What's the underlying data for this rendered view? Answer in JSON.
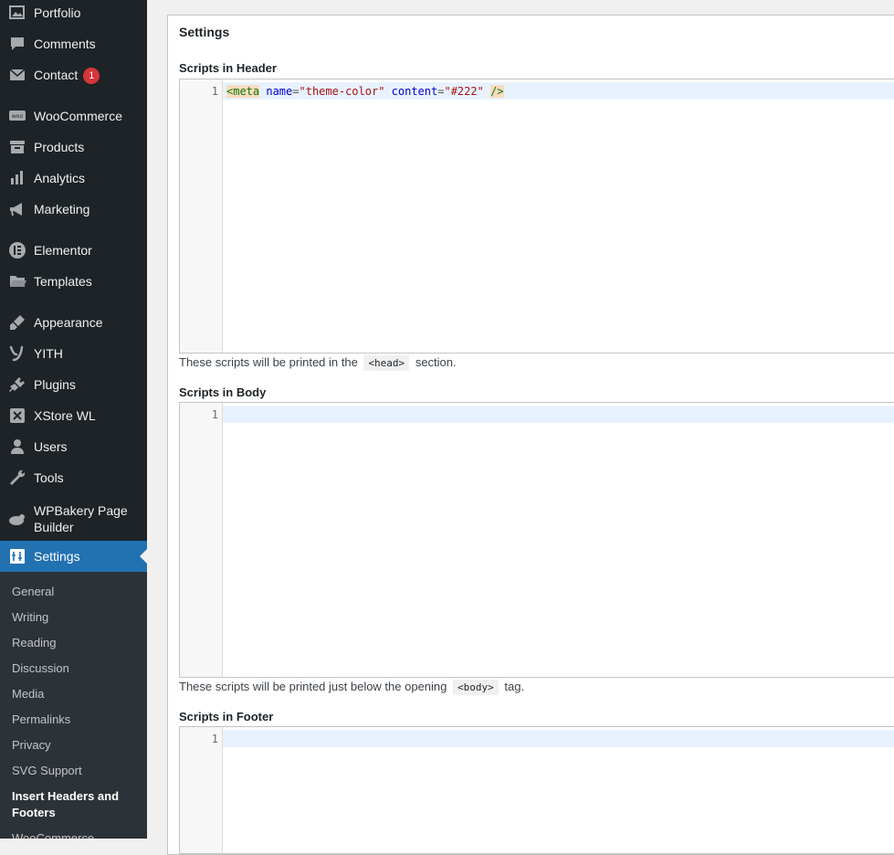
{
  "sidebar": {
    "items": [
      {
        "label": "Portfolio",
        "icon": "portfolio-icon"
      },
      {
        "label": "Comments",
        "icon": "comments-icon"
      },
      {
        "label": "Contact",
        "icon": "mail-icon",
        "badge": "1"
      },
      {
        "label": "WooCommerce",
        "icon": "woocommerce-icon"
      },
      {
        "label": "Products",
        "icon": "archive-icon"
      },
      {
        "label": "Analytics",
        "icon": "bar-chart-icon"
      },
      {
        "label": "Marketing",
        "icon": "megaphone-icon"
      },
      {
        "label": "Elementor",
        "icon": "elementor-icon"
      },
      {
        "label": "Templates",
        "icon": "folder-icon"
      },
      {
        "label": "Appearance",
        "icon": "brush-icon"
      },
      {
        "label": "YITH",
        "icon": "yith-icon"
      },
      {
        "label": "Plugins",
        "icon": "plug-icon"
      },
      {
        "label": "XStore WL",
        "icon": "xstore-icon"
      },
      {
        "label": "Users",
        "icon": "user-icon"
      },
      {
        "label": "Tools",
        "icon": "wrench-icon"
      },
      {
        "label": "WPBakery Page Builder",
        "icon": "wpbakery-icon"
      },
      {
        "label": "Settings",
        "icon": "settings-icon",
        "active": true
      }
    ],
    "submenu": [
      {
        "label": "General"
      },
      {
        "label": "Writing"
      },
      {
        "label": "Reading"
      },
      {
        "label": "Discussion"
      },
      {
        "label": "Media"
      },
      {
        "label": "Permalinks"
      },
      {
        "label": "Privacy"
      },
      {
        "label": "SVG Support"
      },
      {
        "label": "Insert Headers and Footers",
        "current": true
      },
      {
        "label": "WooCommerce"
      }
    ]
  },
  "main": {
    "panel_title": "Settings",
    "header": {
      "label": "Scripts in Header",
      "line_number": "1",
      "code_tokens": {
        "open": "<meta",
        "attr1": "name",
        "eq1": "=",
        "val1": "\"theme-color\"",
        "attr2": "content",
        "eq2": "=",
        "val2": "\"#222\"",
        "close": "/>"
      },
      "help_before": "These scripts will be printed in the",
      "help_code": "<head>",
      "help_after": "section."
    },
    "body": {
      "label": "Scripts in Body",
      "line_number": "1",
      "help_before": "These scripts will be printed just below the opening",
      "help_code": "<body>",
      "help_after": "tag."
    },
    "footer": {
      "label": "Scripts in Footer",
      "line_number": "1"
    }
  },
  "colors": {
    "sidebar_bg": "#1d2327",
    "submenu_bg": "#2c3338",
    "accent": "#2271b1",
    "badge": "#d63638",
    "active_line": "#e8f2fe"
  }
}
